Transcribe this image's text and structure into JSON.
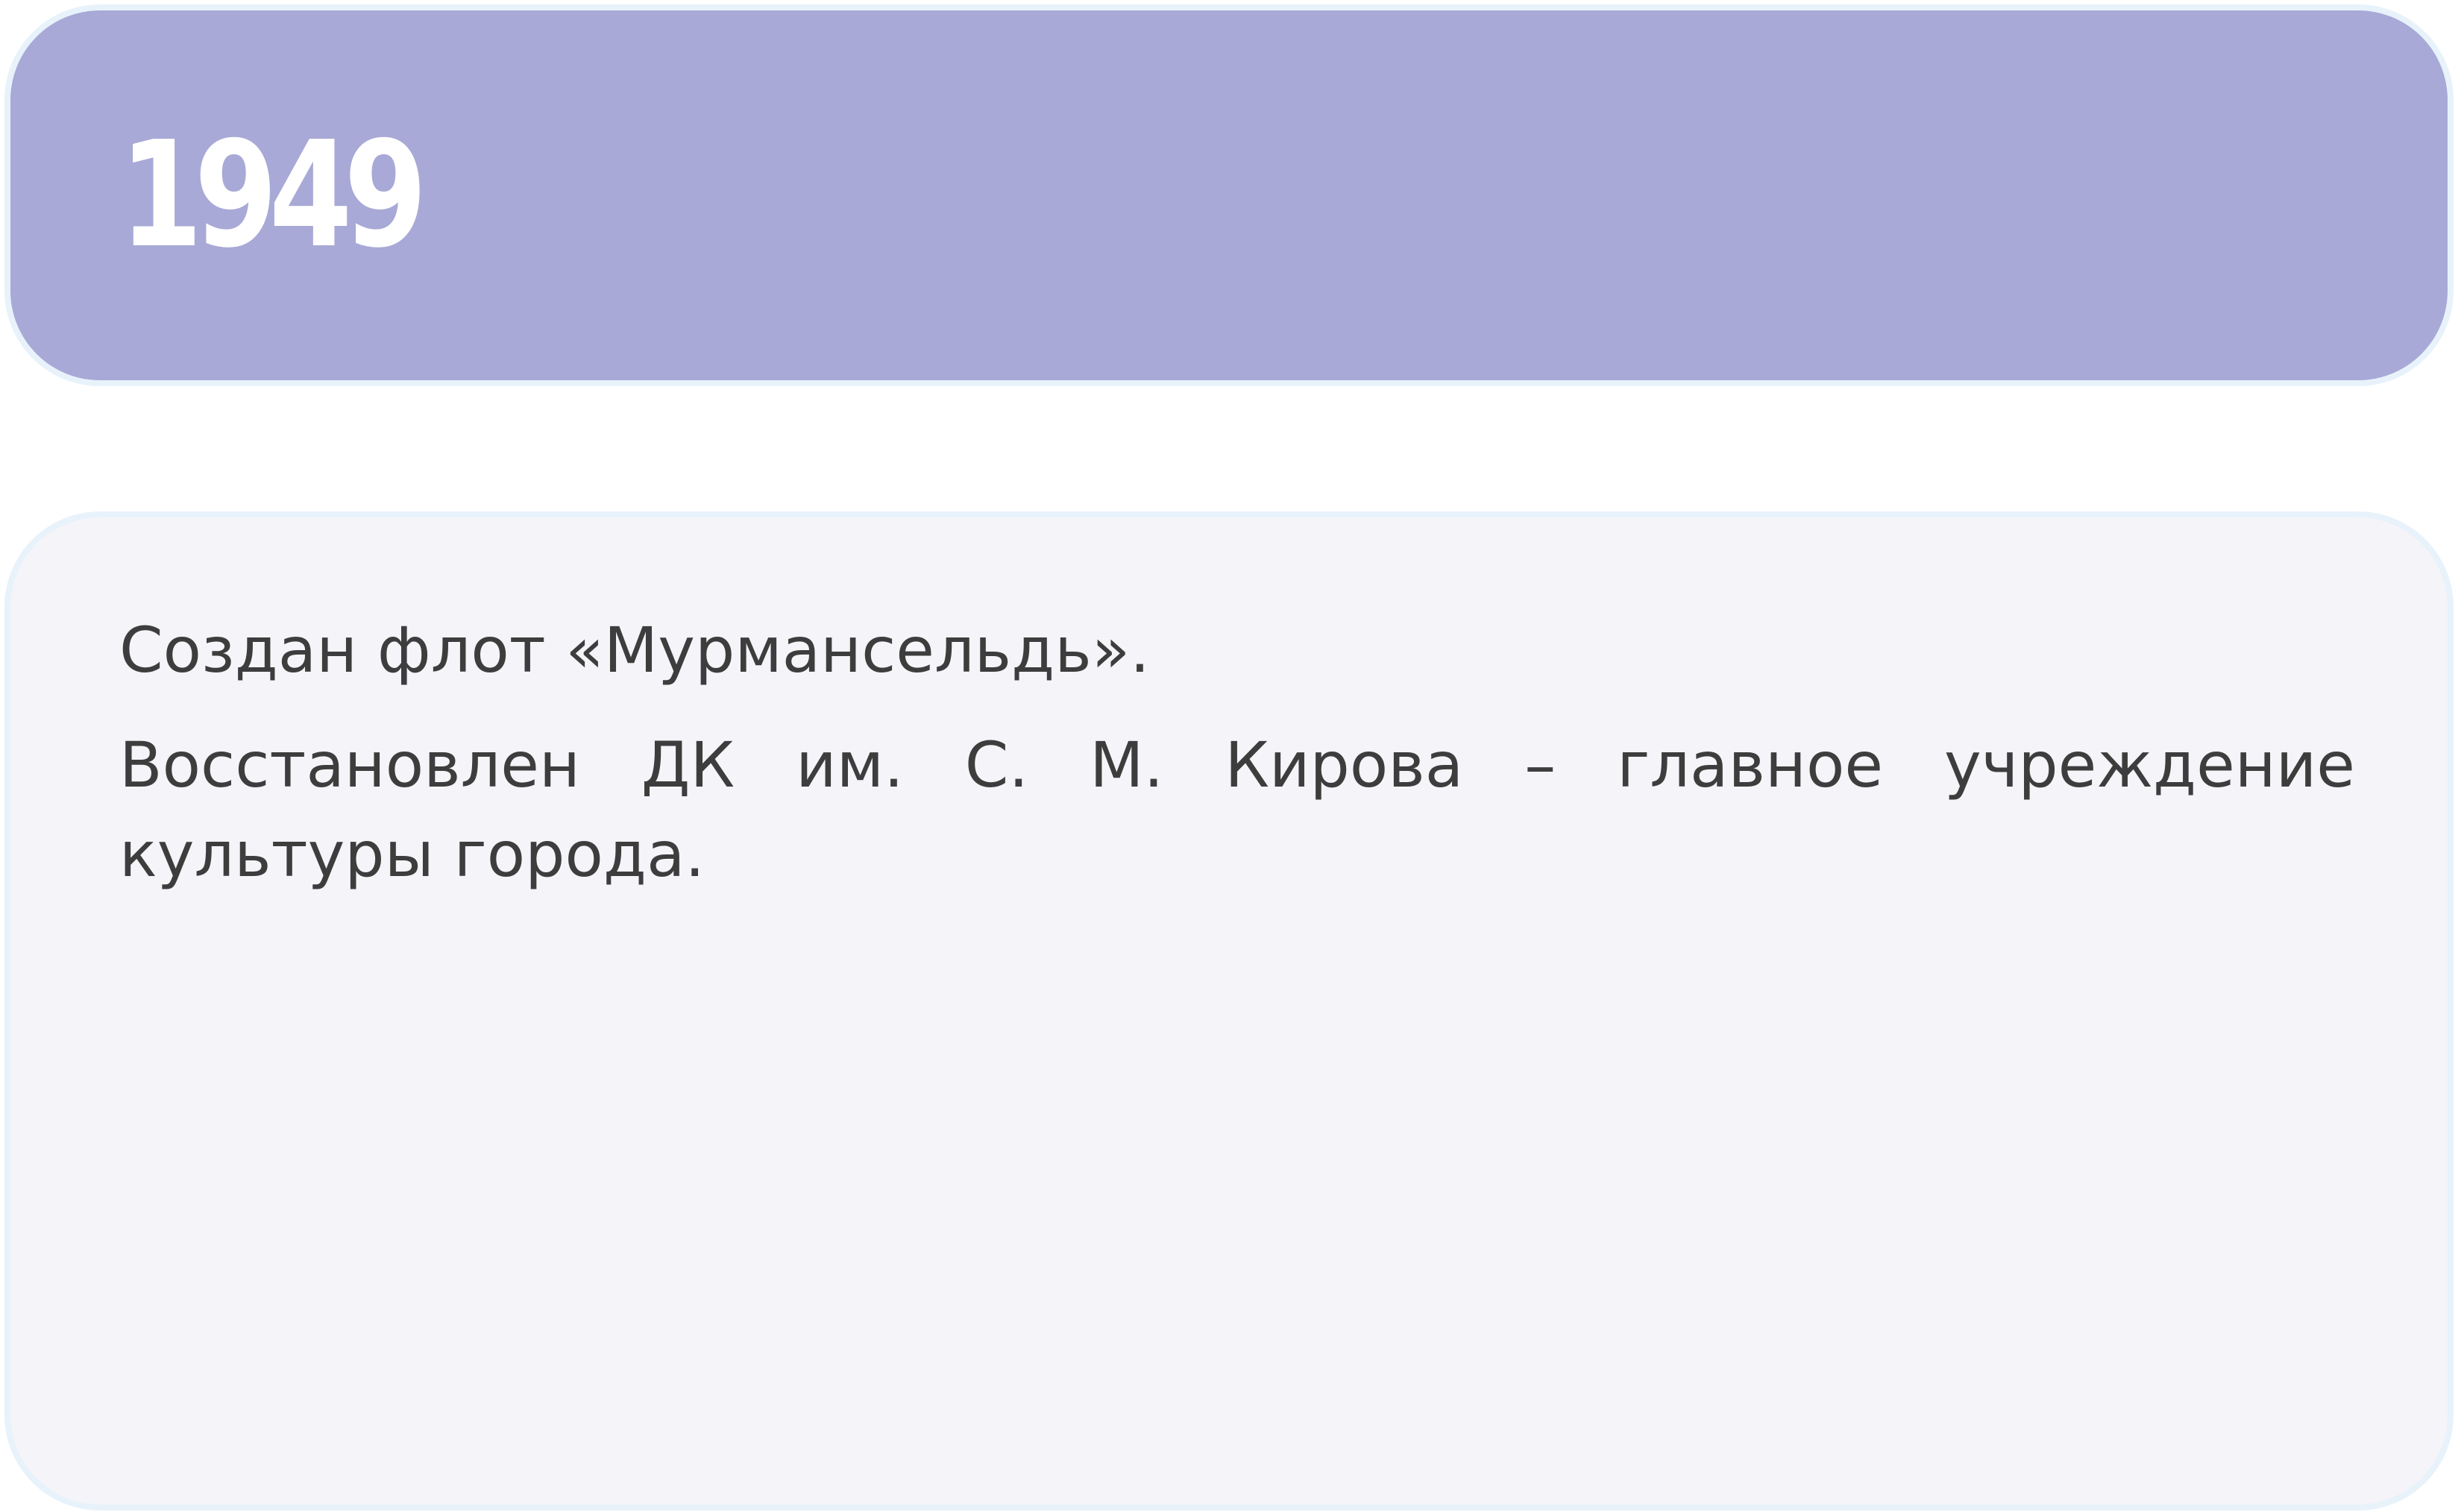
{
  "header": {
    "year": "1949"
  },
  "content": {
    "paragraphs": [
      "Создан флот «Мурмансельдь».",
      "Восстановлен ДК им. С. М. Кирова – главное учреждение культуры города."
    ]
  },
  "colors": {
    "header_bg": "#a8a9d6",
    "content_bg": "#f4f4f9",
    "card_border": "#e8f2fb",
    "year_text": "#ffffff",
    "body_text": "#3d3d3d"
  }
}
